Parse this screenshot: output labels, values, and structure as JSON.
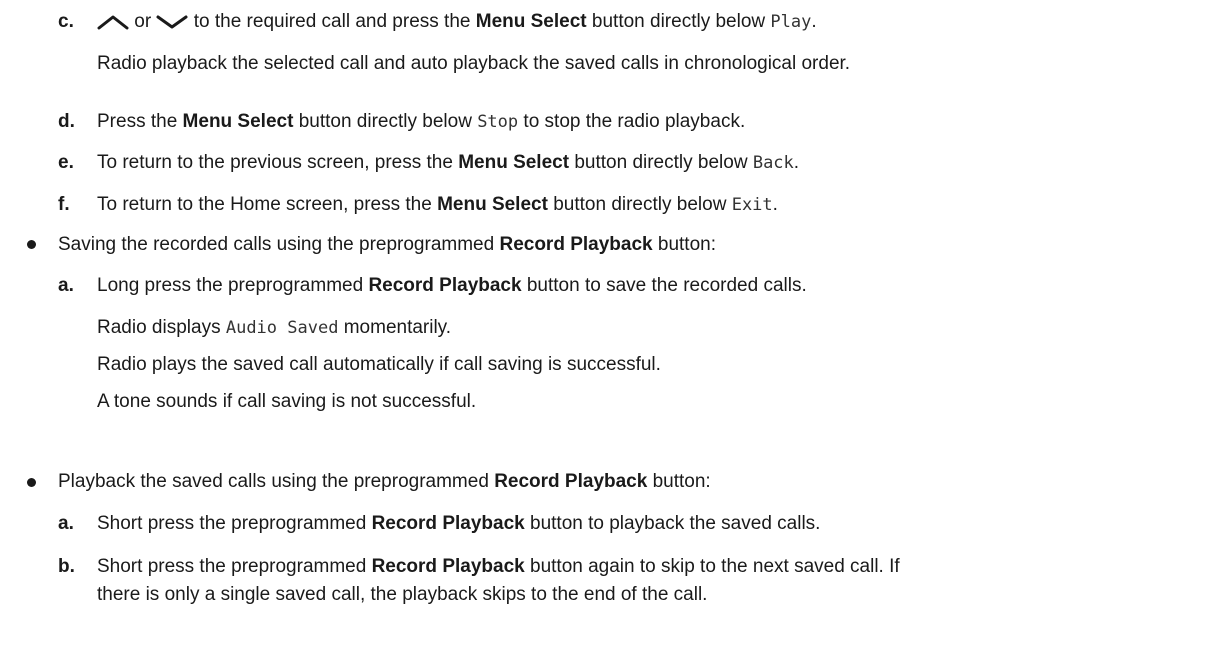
{
  "steps": {
    "c": {
      "label": "c.",
      "or": " or ",
      "pre": " to the required call and press the ",
      "bold": "Menu Select",
      "mid": " button directly below ",
      "code": "Play",
      "end": ".",
      "result": "Radio playback the selected call and auto playback the saved calls in chronological order.",
      "up_icon": "chevron-up-icon",
      "down_icon": "chevron-down-icon"
    },
    "d": {
      "label": "d.",
      "pre": "Press the ",
      "bold": "Menu Select",
      "mid": " button directly below ",
      "code": "Stop",
      "end": " to stop the radio playback."
    },
    "e": {
      "label": "e.",
      "pre": "To return to the previous screen, press the ",
      "bold": "Menu Select",
      "mid": " button directly below ",
      "code": "Back",
      "end": "."
    },
    "f": {
      "label": "f.",
      "pre": "To return to the Home screen, press the ",
      "bold": "Menu Select",
      "mid": " button directly below ",
      "code": "Exit",
      "end": "."
    }
  },
  "saving": {
    "bullet_pre": "Saving the recorded calls using the preprogrammed ",
    "bullet_bold": "Record Playback",
    "bullet_end": " button:",
    "a": {
      "label": "a.",
      "pre": "Long press the preprogrammed ",
      "bold": "Record Playback",
      "end": " button to save the recorded calls."
    },
    "r1_pre": "Radio displays ",
    "r1_code": "Audio Saved",
    "r1_end": " momentarily.",
    "r2": "Radio plays the saved call automatically if call saving is successful.",
    "r3": "A tone sounds if call saving is not successful."
  },
  "playback": {
    "bullet_pre": "Playback the saved calls using the preprogrammed ",
    "bullet_bold": "Record Playback",
    "bullet_end": " button:",
    "a": {
      "label": "a.",
      "pre": "Short press the preprogrammed ",
      "bold": "Record Playback",
      "end": " button to playback the saved calls."
    },
    "b": {
      "label": "b.",
      "pre": "Short press the preprogrammed ",
      "bold": "Record Playback",
      "end": " button again to skip to the next saved call. If",
      "line2": "there is only a single saved call, the playback skips to the end of the call."
    }
  }
}
